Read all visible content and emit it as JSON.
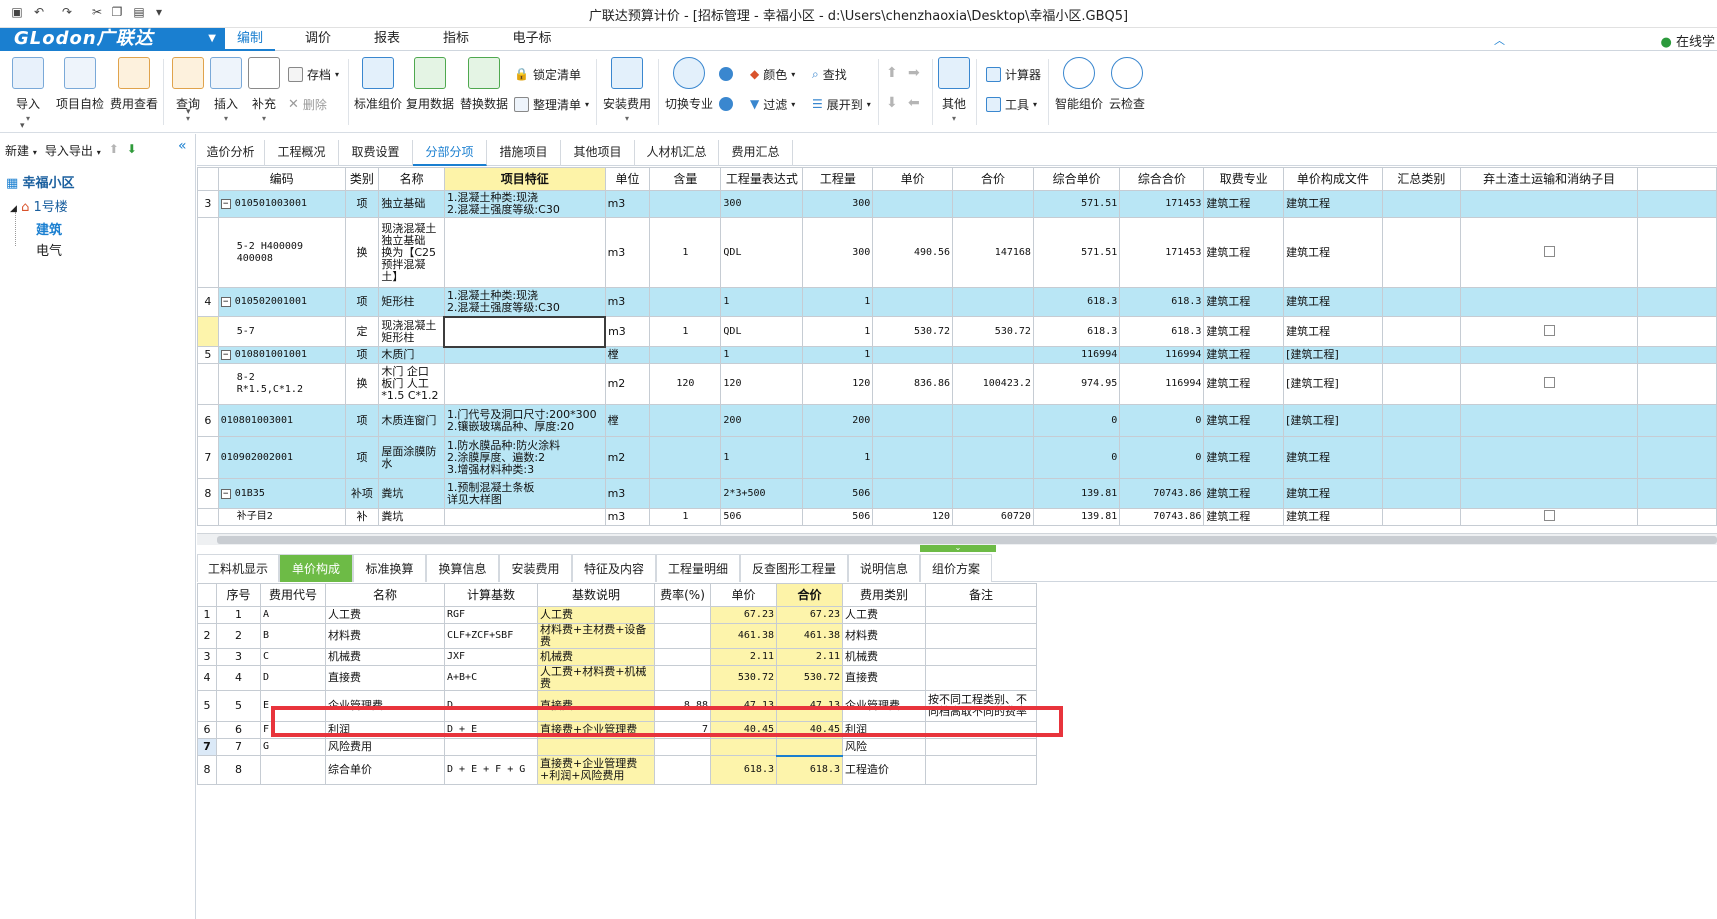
{
  "window": {
    "title": "广联达预算计价 - [招标管理 - 幸福小区 - d:\\Users\\chenzhaoxia\\Desktop\\幸福小区.GBQ5]"
  },
  "ribbon": {
    "logo": "GLodon广联达",
    "tabs": [
      "编制",
      "调价",
      "报表",
      "指标",
      "电子标"
    ],
    "active_tab": "编制",
    "online_label": "在线学"
  },
  "toolbar": {
    "import": "导入",
    "project_check": "项目自检",
    "fee_view": "费用查看",
    "query": "查询",
    "insert": "插入",
    "supplement": "补充",
    "save_file": "存档",
    "delete": "删除",
    "standard_pricing": "标准组价",
    "reuse_data": "复用数据",
    "replace_data": "替换数据",
    "lock_list": "锁定清单",
    "organize_list": "整理清单",
    "install_fee": "安装费用",
    "switch_specialty": "切换专业",
    "color": "颜色",
    "filter": "过滤",
    "find": "查找",
    "expand_to": "展开到",
    "other": "其他",
    "calculator": "计算器",
    "tools": "工具",
    "smart_pricing": "智能组价",
    "cloud_check": "云检查"
  },
  "left_panel": {
    "new": "新建",
    "import_export": "导入导出",
    "project": "幸福小区",
    "building": "1号楼",
    "units": [
      "建筑",
      "电气"
    ],
    "selected_unit": "建筑"
  },
  "main_tabs": [
    "造价分析",
    "工程概况",
    "取费设置",
    "分部分项",
    "措施项目",
    "其他项目",
    "人材机汇总",
    "费用汇总"
  ],
  "main_tabs_active": "分部分项",
  "upper_table": {
    "headers": [
      "编码",
      "类别",
      "名称",
      "项目特征",
      "单位",
      "含量",
      "工程量表达式",
      "工程量",
      "单价",
      "合价",
      "综合单价",
      "综合合价",
      "取费专业",
      "单价构成文件",
      "汇总类别",
      "弃土渣土运输和消纳子目"
    ],
    "rows": [
      {
        "rn": "3",
        "code": "010501003001",
        "type": "项",
        "name": "独立基础",
        "feature": "1.混凝土种类:现浇\n2.混凝土强度等级:C30",
        "unit": "m3",
        "content": "",
        "expr": "300",
        "qty": "300",
        "price": "",
        "total": "",
        "cprice": "571.51",
        "ctotal": "171453",
        "fee": "建筑工程",
        "file": "建筑工程",
        "blue": true,
        "collapse": true
      },
      {
        "rn": "",
        "code": "5-2 H400009\n400008",
        "type": "换",
        "name": "现浇混凝土\n独立基础\n换为【C25\n预拌混凝\n土】",
        "feature": "",
        "unit": "m3",
        "content": "1",
        "expr": "QDL",
        "qty": "300",
        "price": "490.56",
        "total": "147168",
        "cprice": "571.51",
        "ctotal": "171453",
        "fee": "建筑工程",
        "file": "建筑工程",
        "blue": false,
        "check": true
      },
      {
        "rn": "4",
        "code": "010502001001",
        "type": "项",
        "name": "矩形柱",
        "feature": "1.混凝土种类:现浇\n2.混凝土强度等级:C30",
        "unit": "m3",
        "content": "",
        "expr": "1",
        "qty": "1",
        "price": "",
        "total": "",
        "cprice": "618.3",
        "ctotal": "618.3",
        "fee": "建筑工程",
        "file": "建筑工程",
        "blue": true,
        "collapse": true
      },
      {
        "rn": "",
        "code": "5-7",
        "type": "定",
        "name": "现浇混凝土\n矩形柱",
        "feature": "",
        "unit": "m3",
        "content": "1",
        "expr": "QDL",
        "qty": "1",
        "price": "530.72",
        "total": "530.72",
        "cprice": "618.3",
        "ctotal": "618.3",
        "fee": "建筑工程",
        "file": "建筑工程",
        "blue": false,
        "check": true,
        "selected": true
      },
      {
        "rn": "5",
        "code": "010801001001",
        "type": "项",
        "name": "木质门",
        "feature": "",
        "unit": "樘",
        "content": "",
        "expr": "1",
        "qty": "1",
        "price": "",
        "total": "",
        "cprice": "116994",
        "ctotal": "116994",
        "fee": "建筑工程",
        "file": "[建筑工程]",
        "blue": true,
        "collapse": true
      },
      {
        "rn": "",
        "code": "8-2\nR*1.5,C*1.2",
        "type": "换",
        "name": "木门 企口\n板门 人工\n*1.5 C*1.2",
        "feature": "",
        "unit": "m2",
        "content": "120",
        "expr": "120",
        "qty": "120",
        "price": "836.86",
        "total": "100423.2",
        "cprice": "974.95",
        "ctotal": "116994",
        "fee": "建筑工程",
        "file": "[建筑工程]",
        "blue": false,
        "check": true
      },
      {
        "rn": "6",
        "code": "010801003001",
        "type": "项",
        "name": "木质连窗门",
        "feature": "1.门代号及洞口尺寸:200*300\n2.镶嵌玻璃品种、厚度:20",
        "unit": "樘",
        "content": "",
        "expr": "200",
        "qty": "200",
        "price": "",
        "total": "",
        "cprice": "0",
        "ctotal": "0",
        "fee": "建筑工程",
        "file": "[建筑工程]",
        "blue": true
      },
      {
        "rn": "7",
        "code": "010902002001",
        "type": "项",
        "name": "屋面涂膜防\n水",
        "feature": "1.防水膜品种:防火涂料\n2.涂膜厚度、遍数:2\n3.增强材料种类:3",
        "unit": "m2",
        "content": "",
        "expr": "1",
        "qty": "1",
        "price": "",
        "total": "",
        "cprice": "0",
        "ctotal": "0",
        "fee": "建筑工程",
        "file": "建筑工程",
        "blue": true
      },
      {
        "rn": "8",
        "code": "01B35",
        "type": "补项",
        "name": "粪坑",
        "feature": "1.预制混凝土条板\n详见大样图",
        "unit": "m3",
        "content": "",
        "expr": "2*3+500",
        "qty": "506",
        "price": "",
        "total": "",
        "cprice": "139.81",
        "ctotal": "70743.86",
        "fee": "建筑工程",
        "file": "建筑工程",
        "blue": true,
        "collapse": true
      },
      {
        "rn": "",
        "code": "补子目2",
        "type": "补",
        "name": "粪坑",
        "feature": "",
        "unit": "m3",
        "content": "1",
        "expr": "506",
        "qty": "506",
        "price": "120",
        "total": "60720",
        "cprice": "139.81",
        "ctotal": "70743.86",
        "fee": "建筑工程",
        "file": "建筑工程",
        "blue": false,
        "check": true
      }
    ]
  },
  "lower_tabs": [
    "工料机显示",
    "单价构成",
    "标准换算",
    "换算信息",
    "安装费用",
    "特征及内容",
    "工程量明细",
    "反查图形工程量",
    "说明信息",
    "组价方案"
  ],
  "lower_tabs_active": "单价构成",
  "lower_table": {
    "headers": [
      "序号",
      "费用代号",
      "名称",
      "计算基数",
      "基数说明",
      "费率(%)",
      "单价",
      "合价",
      "费用类别",
      "备注"
    ],
    "rows": [
      {
        "rn": "1",
        "no": "1",
        "code": "A",
        "name": "人工费",
        "base": "RGF",
        "desc": "人工费",
        "rate": "",
        "price": "67.23",
        "total": "67.23",
        "cat": "人工费",
        "note": ""
      },
      {
        "rn": "2",
        "no": "2",
        "code": "B",
        "name": "材料费",
        "base": "CLF+ZCF+SBF",
        "desc": "材料费+主材费+设备费",
        "rate": "",
        "price": "461.38",
        "total": "461.38",
        "cat": "材料费",
        "note": ""
      },
      {
        "rn": "3",
        "no": "3",
        "code": "C",
        "name": "机械费",
        "base": "JXF",
        "desc": "机械费",
        "rate": "",
        "price": "2.11",
        "total": "2.11",
        "cat": "机械费",
        "note": ""
      },
      {
        "rn": "4",
        "no": "4",
        "code": "D",
        "name": "直接费",
        "base": "A+B+C",
        "desc": "人工费+材料费+机械费",
        "rate": "",
        "price": "530.72",
        "total": "530.72",
        "cat": "直接费",
        "note": ""
      },
      {
        "rn": "5",
        "no": "5",
        "code": "E",
        "name": "企业管理费",
        "base": "D",
        "desc": "直接费",
        "rate": "8.88",
        "price": "47.13",
        "total": "47.13",
        "cat": "企业管理费",
        "note": "按不同工程类别、不同档高取不同的费率"
      },
      {
        "rn": "6",
        "no": "6",
        "code": "F",
        "name": "利润",
        "base": "D + E",
        "desc": "直接费+企业管理费",
        "rate": "7",
        "price": "40.45",
        "total": "40.45",
        "cat": "利润",
        "note": ""
      },
      {
        "rn": "7",
        "no": "7",
        "code": "G",
        "name": "风险费用",
        "base": "",
        "desc": "",
        "rate": "",
        "price": "",
        "total": "",
        "cat": "风险",
        "note": ""
      },
      {
        "rn": "8",
        "no": "8",
        "code": "",
        "name": "综合单价",
        "base": "D + E + F + G",
        "desc": "直接费+企业管理费+利润+风险费用",
        "rate": "",
        "price": "618.3",
        "total": "618.3",
        "cat": "工程造价",
        "note": ""
      }
    ]
  },
  "colors": {
    "brand": "#1a7fd0",
    "row_blue": "#b9e6f5",
    "highlight_yellow": "#fdf4ab",
    "active_green": "#6dbb46",
    "annotation_red": "#e8343c"
  }
}
